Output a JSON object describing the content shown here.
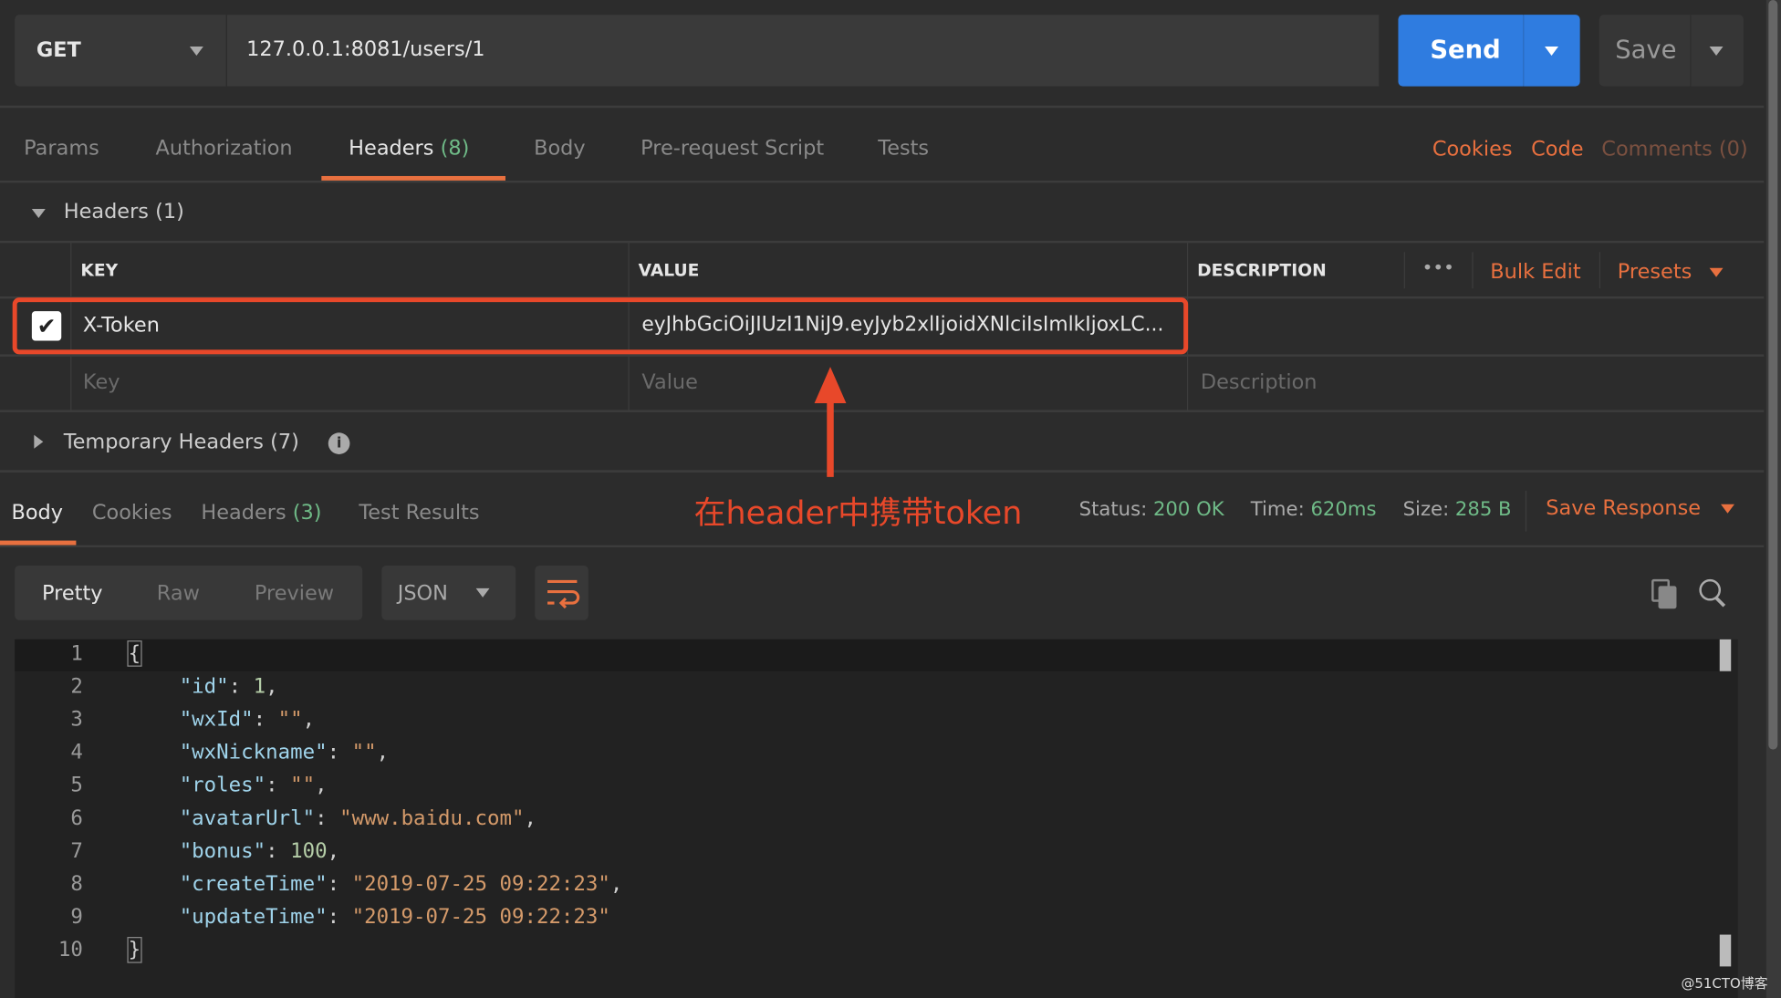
{
  "request": {
    "method": "GET",
    "url": "127.0.0.1:8081/users/1",
    "send_label": "Send",
    "save_label": "Save"
  },
  "request_tabs": [
    {
      "label": "Params"
    },
    {
      "label": "Authorization"
    },
    {
      "label": "Headers",
      "count": "(8)"
    },
    {
      "label": "Body"
    },
    {
      "label": "Pre-request Script"
    },
    {
      "label": "Tests"
    }
  ],
  "request_links": {
    "cookies": "Cookies",
    "code": "Code",
    "comments": "Comments (0)"
  },
  "headers_section": {
    "title": "Headers (1)",
    "columns": {
      "key": "KEY",
      "value": "VALUE",
      "description": "DESCRIPTION"
    },
    "more": "•••",
    "bulk_edit": "Bulk Edit",
    "presets": "Presets",
    "rows": [
      {
        "checked": true,
        "key": "X-Token",
        "value": "eyJhbGciOiJIUzI1NiJ9.eyJyb2xlIjoidXNlciIsImlkIjoxLC..."
      }
    ],
    "placeholder": {
      "key": "Key",
      "value": "Value",
      "description": "Description"
    }
  },
  "temporary_headers": {
    "title": "Temporary Headers (7)"
  },
  "annotation": {
    "text": "在header中携带token",
    "color": "#e8482a"
  },
  "response_tabs": [
    {
      "label": "Body"
    },
    {
      "label": "Cookies"
    },
    {
      "label": "Headers",
      "count": "(3)"
    },
    {
      "label": "Test Results"
    }
  ],
  "response_meta": {
    "status_label": "Status:",
    "status": "200 OK",
    "time_label": "Time:",
    "time": "620ms",
    "size_label": "Size:",
    "size": "285 B",
    "save_response": "Save Response"
  },
  "view_modes": {
    "pretty": "Pretty",
    "raw": "Raw",
    "preview": "Preview",
    "format": "JSON"
  },
  "code_lines": [
    {
      "n": "1",
      "parts": [
        [
          "pun",
          "{"
        ]
      ]
    },
    {
      "n": "2",
      "parts": [
        [
          "key",
          "\"id\""
        ],
        [
          "pun",
          ": "
        ],
        [
          "num",
          "1"
        ],
        [
          "pun",
          ","
        ]
      ]
    },
    {
      "n": "3",
      "parts": [
        [
          "key",
          "\"wxId\""
        ],
        [
          "pun",
          ": "
        ],
        [
          "str",
          "\"\""
        ],
        [
          "pun",
          ","
        ]
      ]
    },
    {
      "n": "4",
      "parts": [
        [
          "key",
          "\"wxNickname\""
        ],
        [
          "pun",
          ": "
        ],
        [
          "str",
          "\"\""
        ],
        [
          "pun",
          ","
        ]
      ]
    },
    {
      "n": "5",
      "parts": [
        [
          "key",
          "\"roles\""
        ],
        [
          "pun",
          ": "
        ],
        [
          "str",
          "\"\""
        ],
        [
          "pun",
          ","
        ]
      ]
    },
    {
      "n": "6",
      "parts": [
        [
          "key",
          "\"avatarUrl\""
        ],
        [
          "pun",
          ": "
        ],
        [
          "str",
          "\"www.baidu.com\""
        ],
        [
          "pun",
          ","
        ]
      ]
    },
    {
      "n": "7",
      "parts": [
        [
          "key",
          "\"bonus\""
        ],
        [
          "pun",
          ": "
        ],
        [
          "num",
          "100"
        ],
        [
          "pun",
          ","
        ]
      ]
    },
    {
      "n": "8",
      "parts": [
        [
          "key",
          "\"createTime\""
        ],
        [
          "pun",
          ": "
        ],
        [
          "str",
          "\"2019-07-25 09:22:23\""
        ],
        [
          "pun",
          ","
        ]
      ]
    },
    {
      "n": "9",
      "parts": [
        [
          "key",
          "\"updateTime\""
        ],
        [
          "pun",
          ": "
        ],
        [
          "str",
          "\"2019-07-25 09:22:23\""
        ]
      ]
    },
    {
      "n": "10",
      "parts": [
        [
          "pun",
          "}"
        ]
      ]
    }
  ],
  "watermark": "@51CTO博客",
  "colors": {
    "accent": "#e8703f",
    "send": "#2f7ce0",
    "success": "#6fba87"
  }
}
